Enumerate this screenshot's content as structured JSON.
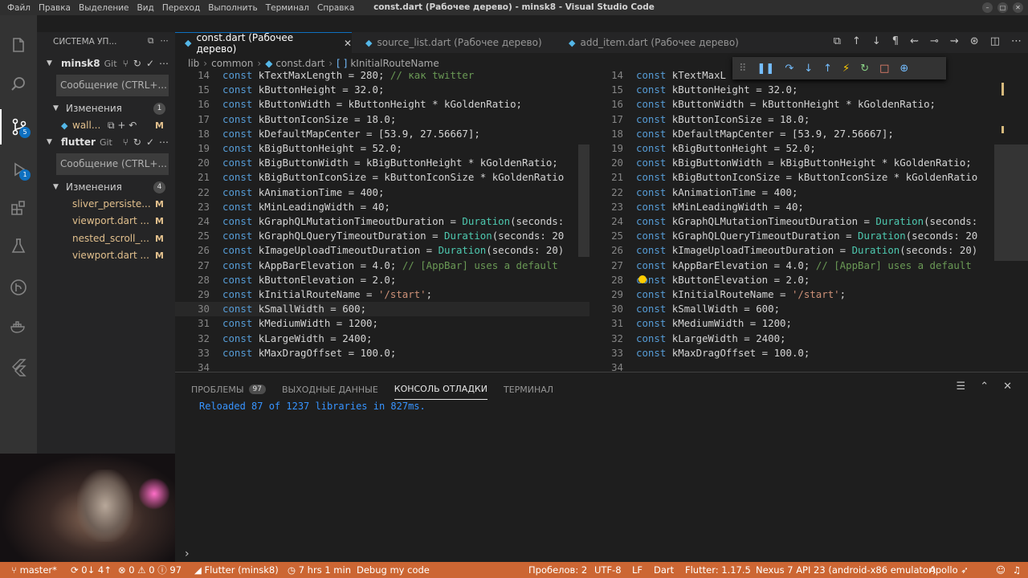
{
  "window": {
    "title": "const.dart (Рабочее дерево) - minsk8 - Visual Studio Code",
    "menu": [
      "Файл",
      "Правка",
      "Выделение",
      "Вид",
      "Переход",
      "Выполнить",
      "Терминал",
      "Справка"
    ]
  },
  "activity_bar": {
    "scm_badge": "5",
    "debug_badge": "1"
  },
  "sidebar": {
    "title": "СИСТЕМА УП...",
    "repos": [
      {
        "name": "minsk8",
        "git": "Git",
        "message_placeholder": "Сообщение (CTRL+...",
        "changes_label": "Изменения",
        "changes_count": "1",
        "files": [
          {
            "name": "wall...",
            "status": "M"
          }
        ]
      },
      {
        "name": "flutter",
        "git": "Git",
        "message_placeholder": "Сообщение (CTRL+...",
        "changes_label": "Изменения",
        "changes_count": "4",
        "files": [
          {
            "name": "sliver_persiste...",
            "status": "M"
          },
          {
            "name": "viewport.dart ...",
            "status": "M"
          },
          {
            "name": "nested_scroll_...",
            "status": "M"
          },
          {
            "name": "viewport.dart ...",
            "status": "M"
          }
        ]
      }
    ]
  },
  "tabs": [
    {
      "label": "const.dart (Рабочее дерево)",
      "active": true
    },
    {
      "label": "source_list.dart (Рабочее дерево)",
      "active": false
    },
    {
      "label": "add_item.dart (Рабочее дерево)",
      "active": false
    }
  ],
  "breadcrumb": [
    "lib",
    "common",
    "const.dart",
    "kInitialRouteName"
  ],
  "editor": {
    "left_lines": [
      {
        "n": "14",
        "code": "const kTextMaxLength = 280; // как twitter"
      },
      {
        "n": "15",
        "code": "const kButtonHeight = 32.0;"
      },
      {
        "n": "16",
        "code": "const kButtonWidth = kButtonHeight * kGoldenRatio;"
      },
      {
        "n": "17",
        "code": "const kButtonIconSize = 18.0;"
      },
      {
        "n": "18",
        "code": "const kDefaultMapCenter = [53.9, 27.56667];"
      },
      {
        "n": "19",
        "code": "const kBigButtonHeight = 52.0;"
      },
      {
        "n": "20",
        "code": "const kBigButtonWidth = kBigButtonHeight * kGoldenRatio;"
      },
      {
        "n": "21",
        "code": "const kBigButtonIconSize = kButtonIconSize * kGoldenRatio"
      },
      {
        "n": "22",
        "code": "const kAnimationTime = 400;"
      },
      {
        "n": "23",
        "code": "const kMinLeadingWidth = 40;"
      },
      {
        "n": "24",
        "code": "const kGraphQLMutationTimeoutDuration = Duration(seconds:"
      },
      {
        "n": "25",
        "code": "const kGraphQLQueryTimeoutDuration = Duration(seconds: 20"
      },
      {
        "n": "26",
        "code": "const kImageUploadTimeoutDuration = Duration(seconds: 20)"
      },
      {
        "n": "27",
        "code": "const kAppBarElevation = 4.0; // [AppBar] uses a default"
      },
      {
        "n": "28",
        "code": "const kButtonElevation = 2.0;"
      },
      {
        "n": "29",
        "code": "const kInitialRouteName = '/start';"
      },
      {
        "n": "30",
        "code": "const kSmallWidth = 600;"
      },
      {
        "n": "31",
        "code": "const kMediumWidth = 1200;"
      },
      {
        "n": "32",
        "code": "const kLargeWidth = 2400;"
      },
      {
        "n": "33",
        "code": "const kMaxDragOffset = 100.0;"
      },
      {
        "n": "34",
        "code": ""
      }
    ],
    "right_lines": [
      {
        "n": "14",
        "code": "const kTextMaxL"
      },
      {
        "n": "15",
        "code": "const kButtonHeight = 32.0;"
      },
      {
        "n": "16",
        "code": "const kButtonWidth = kButtonHeight * kGoldenRatio;"
      },
      {
        "n": "17",
        "code": "const kButtonIconSize = 18.0;"
      },
      {
        "n": "18",
        "code": "const kDefaultMapCenter = [53.9, 27.56667];"
      },
      {
        "n": "19",
        "code": "const kBigButtonHeight = 52.0;"
      },
      {
        "n": "20",
        "code": "const kBigButtonWidth = kBigButtonHeight * kGoldenRatio;"
      },
      {
        "n": "21",
        "code": "const kBigButtonIconSize = kButtonIconSize * kGoldenRatio"
      },
      {
        "n": "22",
        "code": "const kAnimationTime = 400;"
      },
      {
        "n": "23",
        "code": "const kMinLeadingWidth = 40;"
      },
      {
        "n": "24",
        "code": "const kGraphQLMutationTimeoutDuration = Duration(seconds:"
      },
      {
        "n": "25",
        "code": "const kGraphQLQueryTimeoutDuration = Duration(seconds: 20"
      },
      {
        "n": "26",
        "code": "const kImageUploadTimeoutDuration = Duration(seconds: 20)"
      },
      {
        "n": "27",
        "code": "const kAppBarElevation = 4.0; // [AppBar] uses a default"
      },
      {
        "n": "28",
        "code": "const kButtonElevation = 2.0;"
      },
      {
        "n": "29",
        "code": "const kInitialRouteName = '/start';"
      },
      {
        "n": "30",
        "code": "const kSmallWidth = 600;"
      },
      {
        "n": "31",
        "code": "const kMediumWidth = 1200;"
      },
      {
        "n": "32",
        "code": "const kLargeWidth = 2400;"
      },
      {
        "n": "33",
        "code": "const kMaxDragOffset = 100.0;"
      },
      {
        "n": "34",
        "code": ""
      }
    ]
  },
  "panel": {
    "tabs": [
      {
        "label": "ПРОБЛЕМЫ",
        "badge": "97"
      },
      {
        "label": "ВЫХОДНЫЕ ДАННЫЕ"
      },
      {
        "label": "КОНСОЛЬ ОТЛАДКИ",
        "active": true
      },
      {
        "label": "ТЕРМИНАЛ"
      }
    ],
    "console_output": "Reloaded 87 of 1237 libraries in 827ms.",
    "prompt": "›"
  },
  "status_bar": {
    "color": "#cc6633",
    "branch": "master*",
    "sync": "0↓ 4↑",
    "errors": "0",
    "warnings": "0",
    "infos": "97",
    "flutter_project": "Flutter (minsk8)",
    "time": "7 hrs 1 min",
    "debug_mode": "Debug my code",
    "spaces": "Пробелов: 2",
    "encoding": "UTF-8",
    "eol": "LF",
    "language": "Dart",
    "flutter_version": "Flutter: 1.17.5",
    "device": "Nexus 7 API 23 (android-x86 emulator)",
    "apollo": "Apollo"
  }
}
